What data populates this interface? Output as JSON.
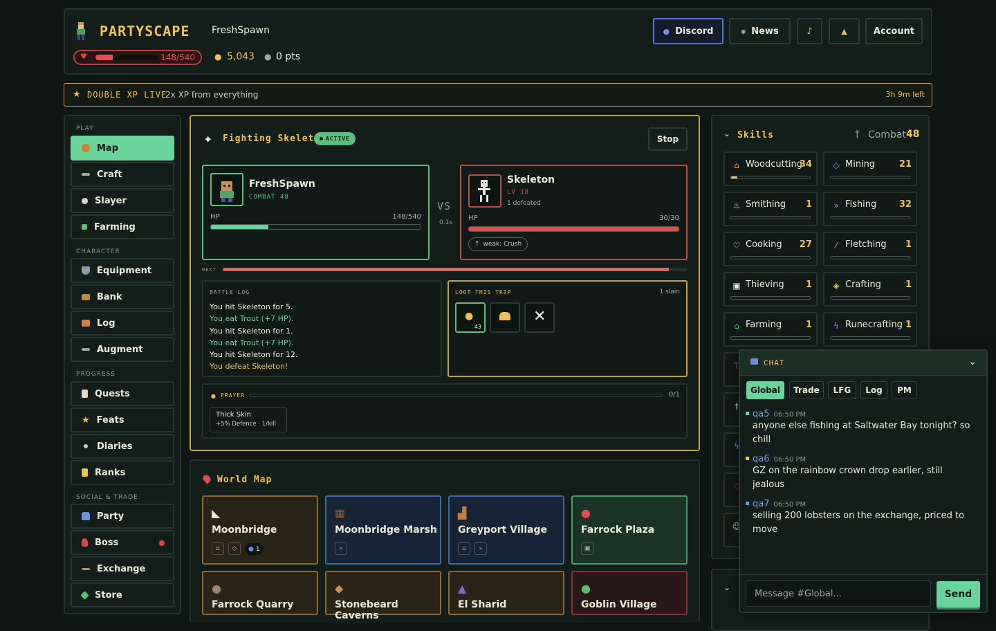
{
  "header": {
    "logo": "PARTYSCAPE",
    "username": "FreshSpawn",
    "hp_text": "148/540",
    "hp_fraction": 0.274,
    "gold": "5,043",
    "points": "0 pts",
    "buttons": {
      "discord": "Discord",
      "news": "News",
      "music_icon": "♪",
      "bell_icon": "🔔",
      "account": "Account"
    }
  },
  "banner": {
    "title": "DOUBLE XP LIVE",
    "subtitle": "2x XP from everything",
    "time_left": "3h 9m left"
  },
  "sidebar": {
    "groups": {
      "play": "PLAY",
      "character": "CHARACTER",
      "progress": "PROGRESS",
      "social": "SOCIAL & TRADE"
    },
    "items": [
      {
        "label": "Map",
        "icon": "compass-icon"
      },
      {
        "label": "Craft",
        "icon": "hammer-icon"
      },
      {
        "label": "Slayer",
        "icon": "skull-icon"
      },
      {
        "label": "Farming",
        "icon": "sprout-icon"
      },
      {
        "label": "Equipment",
        "icon": "shield-icon"
      },
      {
        "label": "Bank",
        "icon": "chest-icon"
      },
      {
        "label": "Log",
        "icon": "book-icon"
      },
      {
        "label": "Augment",
        "icon": "wand-icon"
      },
      {
        "label": "Quests",
        "icon": "scroll-icon"
      },
      {
        "label": "Feats",
        "icon": "star-icon"
      },
      {
        "label": "Diaries",
        "icon": "dot-icon"
      },
      {
        "label": "Ranks",
        "icon": "trophy-icon"
      },
      {
        "label": "Party",
        "icon": "people-icon"
      },
      {
        "label": "Boss",
        "icon": "demon-icon"
      },
      {
        "label": "Exchange",
        "icon": "scale-icon"
      },
      {
        "label": "Store",
        "icon": "gem-icon"
      }
    ]
  },
  "fight": {
    "title": "Fighting Skeleton",
    "status": "ACTIVE",
    "stop": "Stop",
    "player": {
      "name": "FreshSpawn",
      "combat": "COMBAT 48",
      "hp_label": "HP",
      "hp_text": "148/540",
      "hp_fraction": 0.274
    },
    "vs": "VS",
    "vs_time": "0.1s",
    "enemy": {
      "name": "Skeleton",
      "level": "LV 18",
      "defeated": "1 defeated",
      "hp_label": "HP",
      "hp_text": "30/30",
      "hp_fraction": 1.0,
      "weakness": "weak: Crush"
    },
    "next_label": "NEXT",
    "next_fraction": 0.96,
    "battle_log_title": "BATTLE LOG",
    "battle_log": [
      {
        "text": "You hit Skeleton for 5.",
        "color": "#e8ecd8"
      },
      {
        "text": "You eat Trout (+7 HP).",
        "color": "#6ad49a"
      },
      {
        "text": "You hit Skeleton for 1.",
        "color": "#e8ecd8"
      },
      {
        "text": "You eat Trout (+7 HP).",
        "color": "#6ad49a"
      },
      {
        "text": "You hit Skeleton for 12.",
        "color": "#e8ecd8"
      },
      {
        "text": "You defeat Skeleton!",
        "color": "#f0c050"
      }
    ],
    "loot_title": "LOOT THIS TRIP",
    "loot_count": "1 slain",
    "loot_qty": "43",
    "prayer_title": "PRAYER",
    "prayer_count": "0/1",
    "prayer_name": "Thick Skin",
    "prayer_desc": "+5% Defence · 1/kill"
  },
  "world_map": {
    "title": "World Map",
    "locations": [
      {
        "name": "Moonbridge",
        "party": "1"
      },
      {
        "name": "Moonbridge Marsh"
      },
      {
        "name": "Greyport Village"
      },
      {
        "name": "Farrock Plaza"
      },
      {
        "name": "Farrock Quarry"
      },
      {
        "name": "Stonebeard Caverns"
      },
      {
        "name": "El Sharid"
      },
      {
        "name": "Goblin Village"
      }
    ]
  },
  "skills": {
    "title": "Skills",
    "combat_label": "Combat",
    "combat_level": "48",
    "list": [
      {
        "name": "Woodcutting",
        "level": "34",
        "progress": 0.08
      },
      {
        "name": "Mining",
        "level": "21",
        "progress": 0
      },
      {
        "name": "Smithing",
        "level": "1",
        "progress": 0
      },
      {
        "name": "Fishing",
        "level": "32",
        "progress": 0
      },
      {
        "name": "Cooking",
        "level": "27",
        "progress": 0
      },
      {
        "name": "Fletching",
        "level": "1",
        "progress": 0
      },
      {
        "name": "Thieving",
        "level": "1",
        "progress": 0
      },
      {
        "name": "Crafting",
        "level": "1",
        "progress": 0
      },
      {
        "name": "Farming",
        "level": "1",
        "progress": 0
      },
      {
        "name": "Runecrafting",
        "level": "1",
        "progress": 0
      }
    ]
  },
  "chat": {
    "title": "CHAT",
    "tabs": [
      "Global",
      "Trade",
      "LFG",
      "Log",
      "PM"
    ],
    "messages": [
      {
        "user": "qa5",
        "time": "06:50 PM",
        "text": "anyone else fishing at Saltwater Bay tonight? so chill"
      },
      {
        "user": "qa6",
        "time": "06:50 PM",
        "text": "GZ on the rainbow crown drop earlier, still jealous"
      },
      {
        "user": "qa7",
        "time": "06:50 PM",
        "text": "selling 200 lobsters on the exchange, priced to move"
      }
    ],
    "input_placeholder": "Message #Global...",
    "send": "Send"
  }
}
